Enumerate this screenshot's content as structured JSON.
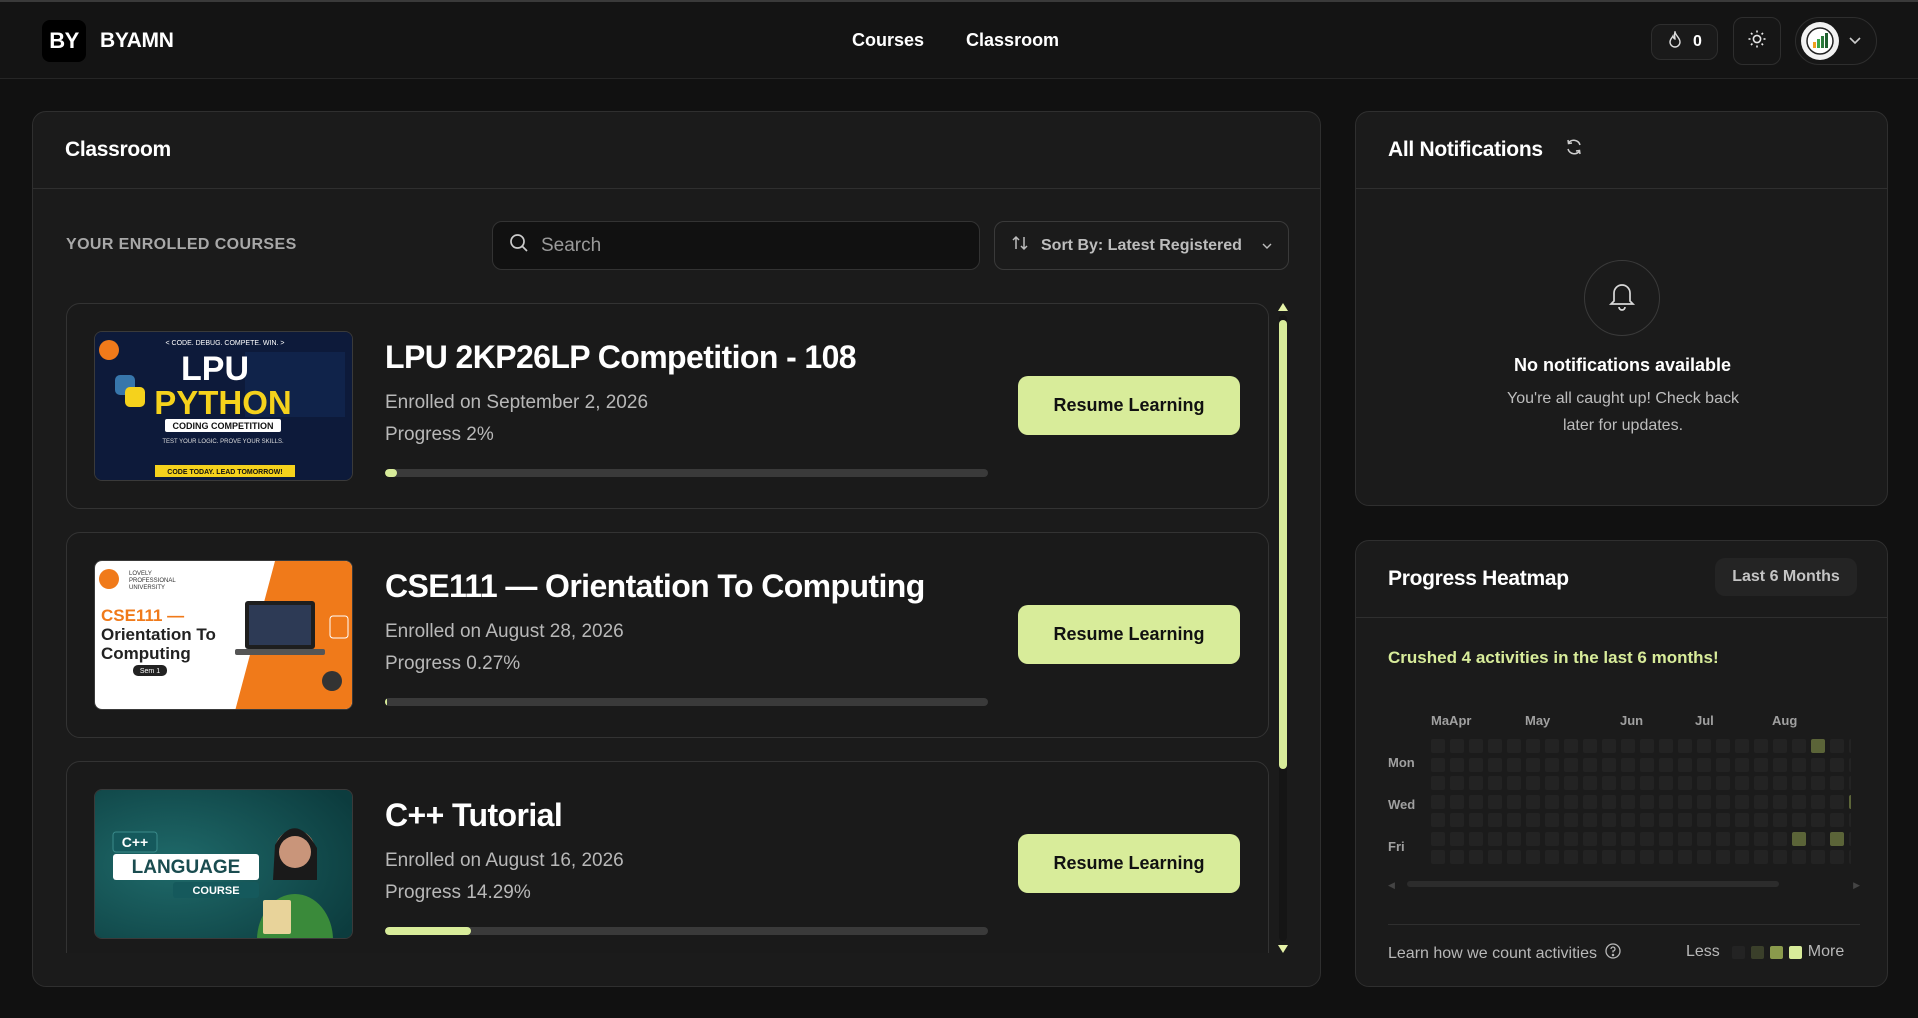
{
  "brand": {
    "mark": "BY",
    "name": "BYAMN"
  },
  "nav": {
    "courses": "Courses",
    "classroom": "Classroom"
  },
  "header": {
    "streak_count": "0"
  },
  "classroom": {
    "title": "Classroom",
    "section_label": "YOUR ENROLLED COURSES",
    "search_placeholder": "Search",
    "sort_label": "Sort By: Latest Registered",
    "resume_label": "Resume Learning",
    "courses": [
      {
        "title": "LPU 2KP26LP Competition - 108",
        "enrolled": "Enrolled on September 2, 2026",
        "progress_text": "Progress 2%",
        "progress": 0.02,
        "thumb": {
          "top": "< CODE. DEBUG. COMPETE. WIN. >",
          "line1": "LPU",
          "line2": "PYTHON",
          "badge": "CODING COMPETITION",
          "tag": "TEST YOUR LOGIC. PROVE YOUR SKILLS.",
          "footer": "CODE TODAY. LEAD TOMORROW!"
        }
      },
      {
        "title": "CSE111 — Orientation To Computing",
        "enrolled": "Enrolled on August 28, 2026",
        "progress_text": "Progress 0.27%",
        "progress": 0.0027,
        "thumb": {
          "uni1": "LOVELY",
          "uni2": "PROFESSIONAL",
          "uni3": "UNIVERSITY",
          "code": "CSE111 —",
          "line1": "Orientation To",
          "line2": "Computing",
          "sem": "Sem 1"
        }
      },
      {
        "title": "C++ Tutorial",
        "enrolled": "Enrolled on August 16, 2026",
        "progress_text": "Progress 14.29%",
        "progress": 0.1429,
        "thumb": {
          "tag": "C++",
          "line1": "LANGUAGE",
          "line2": "COURSE"
        }
      }
    ]
  },
  "notifications": {
    "title": "All Notifications",
    "empty_title": "No notifications available",
    "empty_body": "You're all caught up! Check back later for updates."
  },
  "heatmap": {
    "title": "Progress Heatmap",
    "range": "Last 6 Months",
    "summary": "Crushed 4 activities in the last 6 months!",
    "months": [
      "MaApr",
      "May",
      "Jun",
      "Jul",
      "Aug"
    ],
    "days": [
      "Mon",
      "Wed",
      "Fri"
    ],
    "footer": "Learn how we count activities",
    "legend_less": "Less",
    "legend_more": "More",
    "colors": {
      "empty": "#232323",
      "level1": "#3a3f2a",
      "level2": "#5b6438",
      "level3": "#8a9a4c",
      "level4": "#d8ec9a"
    },
    "active_cells": [
      {
        "week": 20,
        "day": 0,
        "level": 2
      },
      {
        "week": 22,
        "day": 3,
        "level": 2
      },
      {
        "week": 19,
        "day": 5,
        "level": 2
      },
      {
        "week": 21,
        "day": 5,
        "level": 2
      }
    ]
  },
  "accent": "#d8ec9a"
}
